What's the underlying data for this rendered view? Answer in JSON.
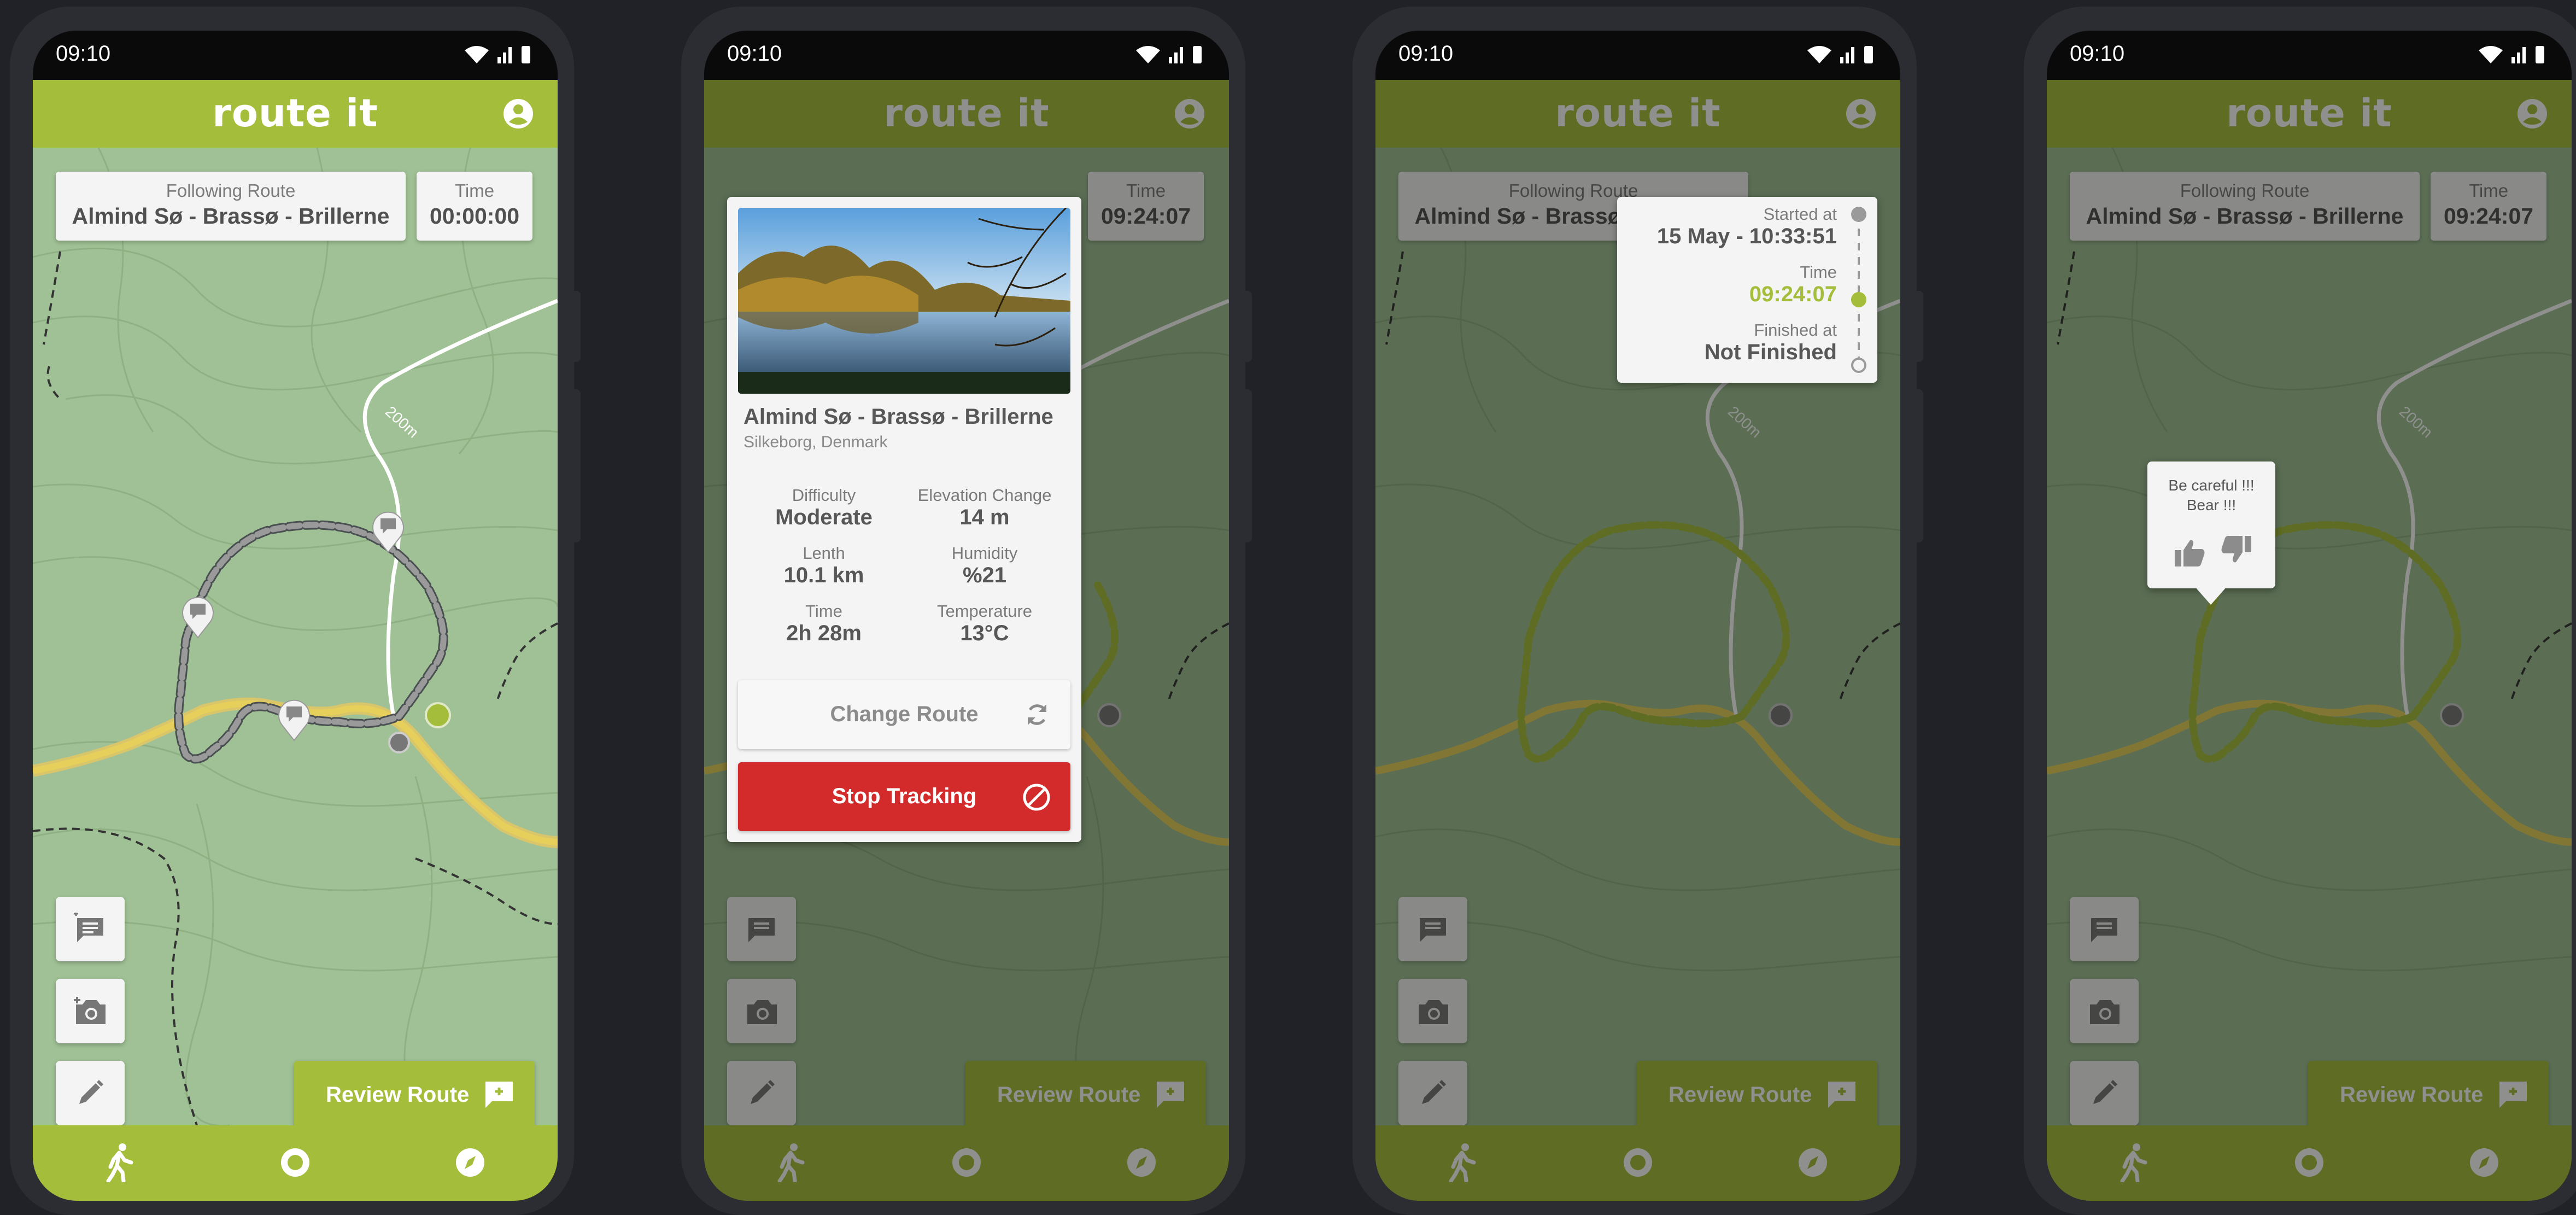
{
  "status": {
    "time": "09:10"
  },
  "app": {
    "title": "route it"
  },
  "route": {
    "following_label": "Following Route",
    "name": "Almind Sø - Brassø - Brillerne",
    "location": "Silkeborg, Denmark"
  },
  "timer": {
    "label": "Time",
    "screen1_value": "00:00:00",
    "running_value": "09:24:07"
  },
  "map": {
    "contour_label": "200m"
  },
  "review_button": {
    "label": "Review Route"
  },
  "tools": [
    "add-comment-icon",
    "add-photo-icon",
    "edit-icon"
  ],
  "navbar": {
    "items": [
      "walk-icon",
      "record-icon",
      "compass-icon"
    ]
  },
  "details": {
    "difficulty_label": "Difficulty",
    "difficulty": "Moderate",
    "elevation_label": "Elevation Change",
    "elevation": "14 m",
    "length_label": "Lenth",
    "length": "10.1 km",
    "humidity_label": "Humidity",
    "humidity": "%21",
    "time_label": "Time",
    "time": "2h 28m",
    "temperature_label": "Temperature",
    "temperature": "13°C",
    "change_route_label": "Change Route",
    "stop_tracking_label": "Stop Tracking"
  },
  "timeline": {
    "started_label": "Started at",
    "started_value": "15 May - 10:33:51",
    "time_label": "Time",
    "time_value": "09:24:07",
    "finished_label": "Finished at",
    "finished_value": "Not Finished"
  },
  "comment": {
    "text_line1": "Be careful !!!",
    "text_line2": "Bear !!!"
  },
  "colors": {
    "accent": "#a4bd3b",
    "map": "#a0c195",
    "danger": "#d32b2b",
    "card": "#f4f4f4"
  }
}
